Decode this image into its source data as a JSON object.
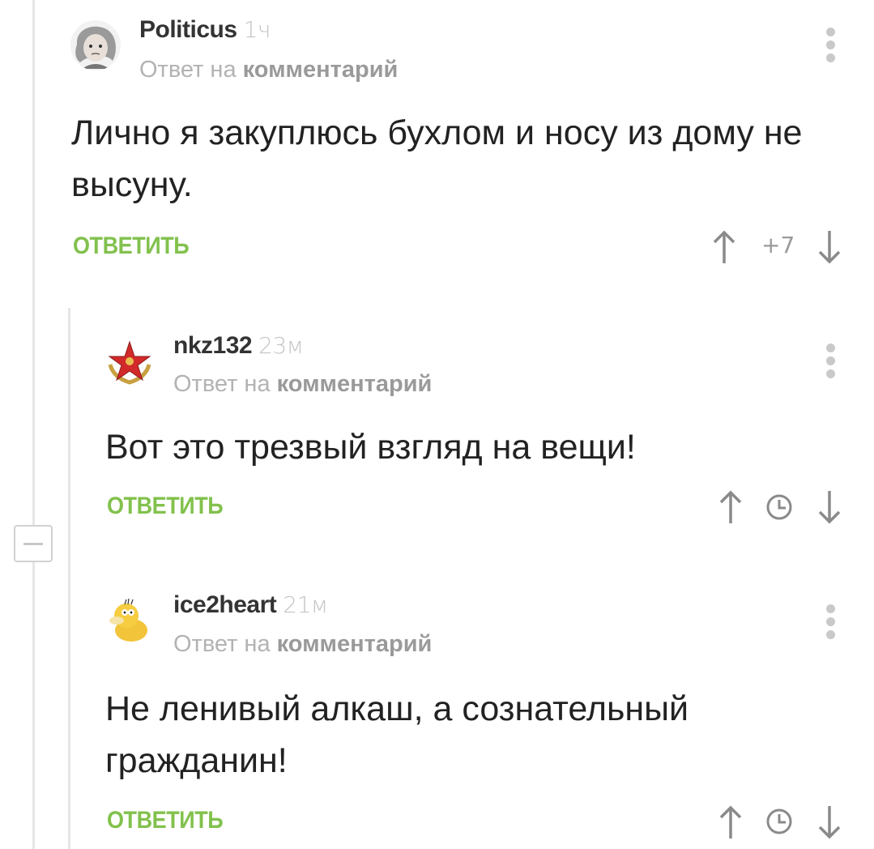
{
  "comments": [
    {
      "username": "Politicus",
      "time": "1ч",
      "reply_prefix": "Ответ на",
      "reply_target": "комментарий",
      "text": "Лично я закуплюсь бухлом и носу из дому не высуну.",
      "reply_label": "ОТВЕТИТЬ",
      "rating": "+7"
    },
    {
      "username": "nkz132",
      "time": "23м",
      "reply_prefix": "Ответ на",
      "reply_target": "комментарий",
      "text": "Вот это трезвый взгляд на вещи!",
      "reply_label": "ОТВЕТИТЬ"
    },
    {
      "username": "ice2heart",
      "time": "21м",
      "reply_prefix": "Ответ на",
      "reply_target": "комментарий",
      "text": "Не ленивый алкаш, а сознательный гражданин!",
      "reply_label": "ОТВЕТИТЬ"
    }
  ],
  "colors": {
    "accent_green": "#82c14d",
    "text_dark": "#222222",
    "muted": "#b3b3b3",
    "thread_line": "#e6e6e6"
  },
  "icons": [
    "upvote-arrow-icon",
    "downvote-arrow-icon",
    "clock-icon",
    "more-dots-icon",
    "collapse-minus-icon"
  ]
}
